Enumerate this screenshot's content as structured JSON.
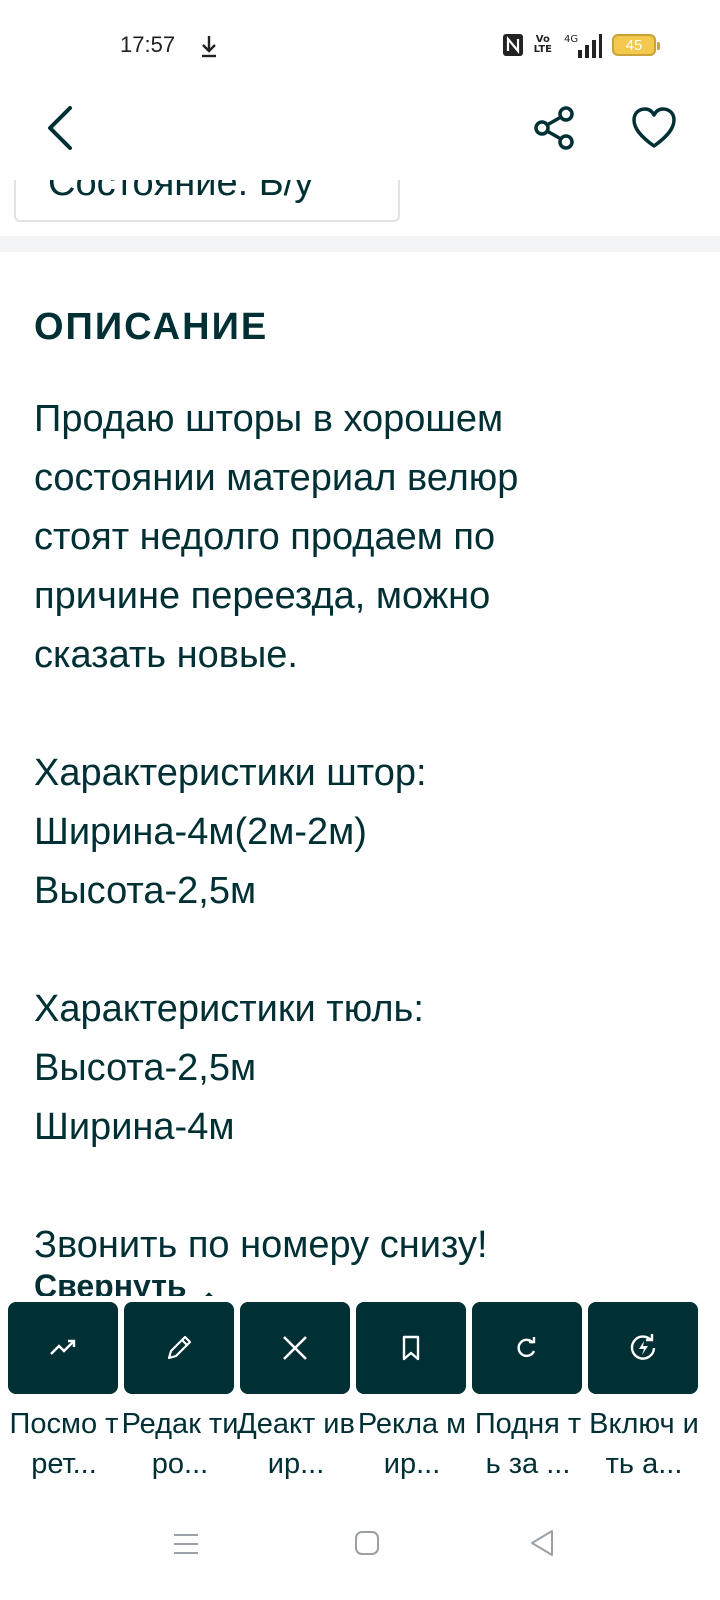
{
  "status_bar": {
    "time": "17:57",
    "volte_top": "Vo",
    "volte_bottom": "LTE",
    "network": "4G",
    "battery": "45"
  },
  "header": {
    "back_icon": "chevron-left-icon",
    "share_icon": "share-icon",
    "favorite_icon": "heart-icon"
  },
  "params": {
    "condition": "Состояние: Б/у"
  },
  "description": {
    "title": "ОПИСАНИЕ",
    "paragraph1": "Продаю шторы в хорошем\nсостоянии материал велюр\nстоят недолго продаем по\nпричине переезда, можно\nсказать новые.",
    "paragraph2": "Характеристики штор:\nШирина-4м(2м-2м)\nВысота-2,5м",
    "paragraph3": "Характеристики тюль:\nВысота-2,5м\nШирина-4м",
    "paragraph4": "Звонить по номеру снизу!",
    "collapse_label": "Свернуть"
  },
  "actions": [
    {
      "label": "Посмо трет...",
      "icon": "trend-up-icon"
    },
    {
      "label": "Редак тиро...",
      "icon": "pencil-icon"
    },
    {
      "label": "Деакт ивир...",
      "icon": "close-icon"
    },
    {
      "label": "Рекла мир...",
      "icon": "bookmark-icon"
    },
    {
      "label": "Подня ть за ...",
      "icon": "refresh-icon"
    },
    {
      "label": "Включ ить а...",
      "icon": "auto-renew-icon"
    }
  ],
  "colors": {
    "primary": "#002f34",
    "divider": "#f2f4f5",
    "battery": "#f2c94c"
  }
}
